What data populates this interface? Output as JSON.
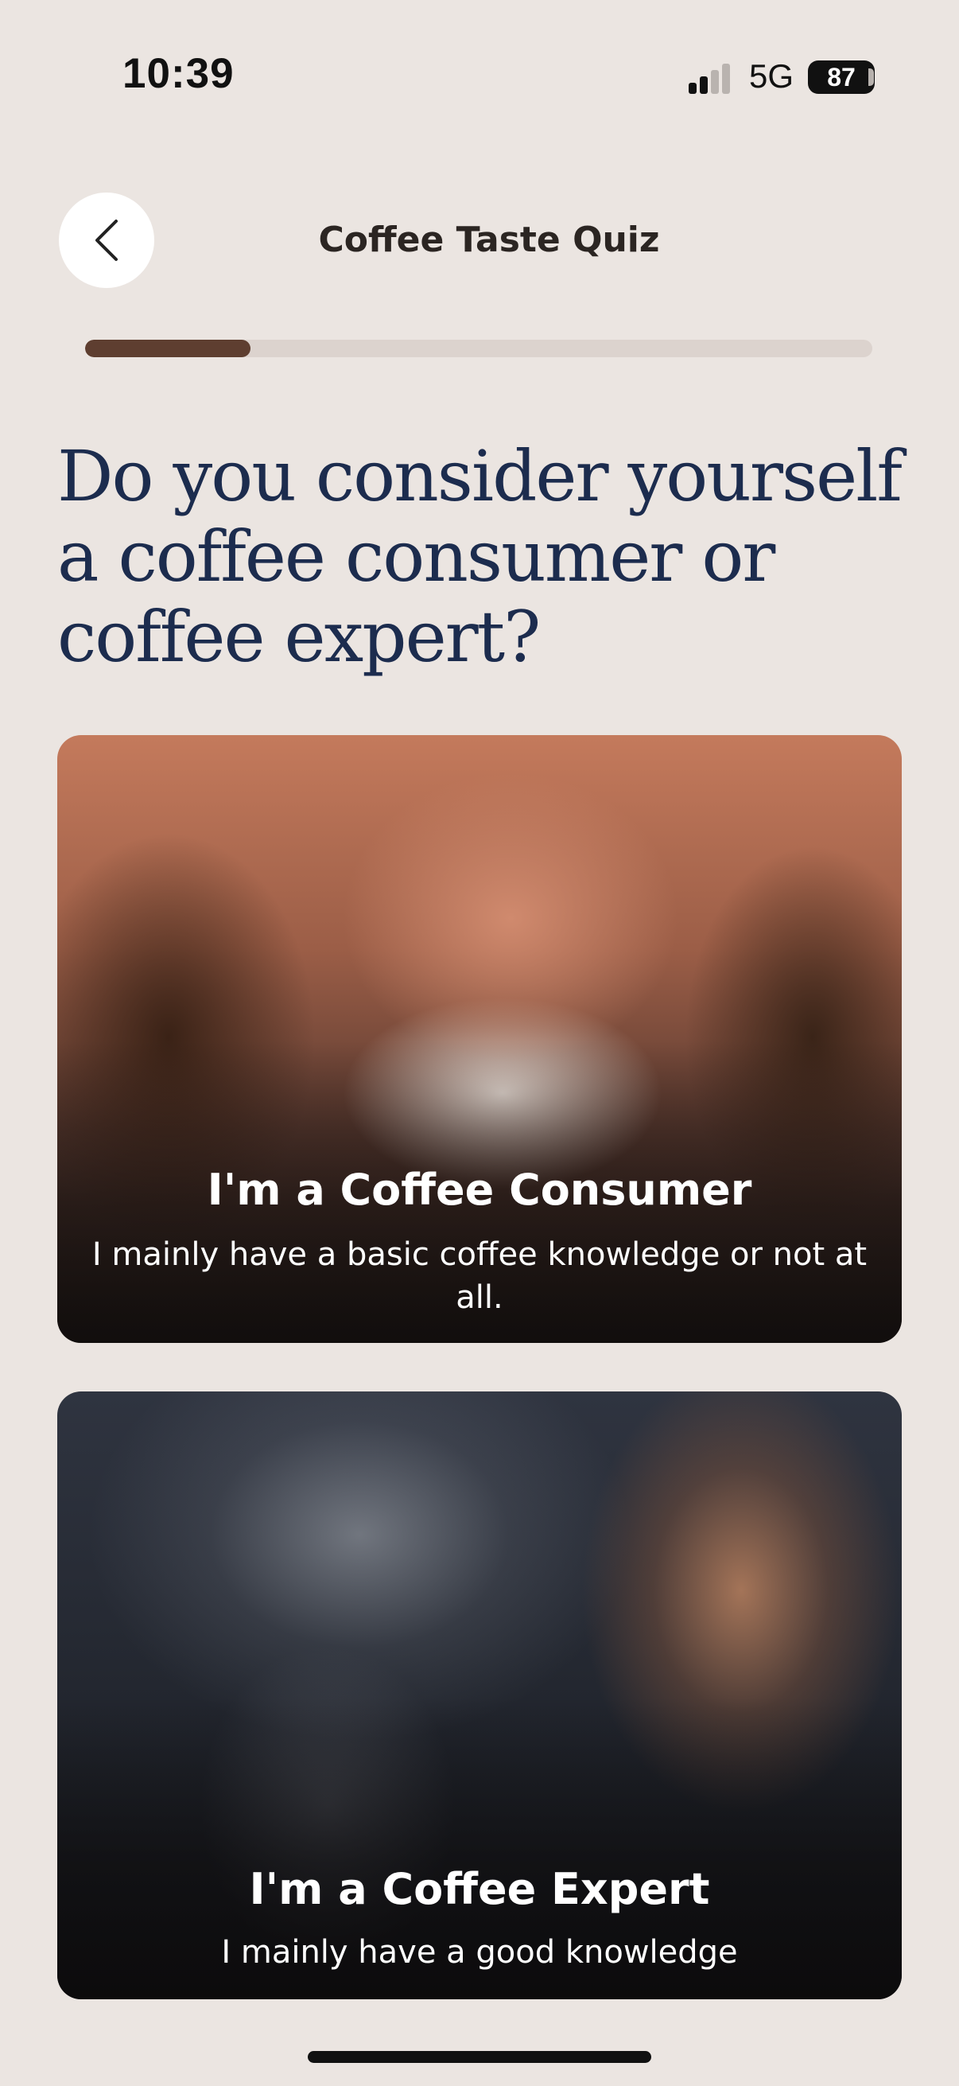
{
  "status_bar": {
    "time": "10:39",
    "network": "5G",
    "battery": "87",
    "signal_bars_filled": 2,
    "signal_bars_total": 4
  },
  "header": {
    "title": "Coffee Taste Quiz",
    "back_icon": "chevron-left-icon"
  },
  "progress": {
    "fraction": 0.21
  },
  "question": "Do you consider yourself a coffee consumer or coffee expert?",
  "options": [
    {
      "title": "I'm a Coffee Consumer",
      "description": "I mainly have a basic coffee knowledge or not at all."
    },
    {
      "title": "I'm a Coffee Expert",
      "description": "I mainly have a good knowledge"
    }
  ],
  "colors": {
    "background": "#ebe5e1",
    "progress_fill": "#5e3e30",
    "progress_track": "#dcd3ce",
    "question_text": "#1c2c4e"
  }
}
